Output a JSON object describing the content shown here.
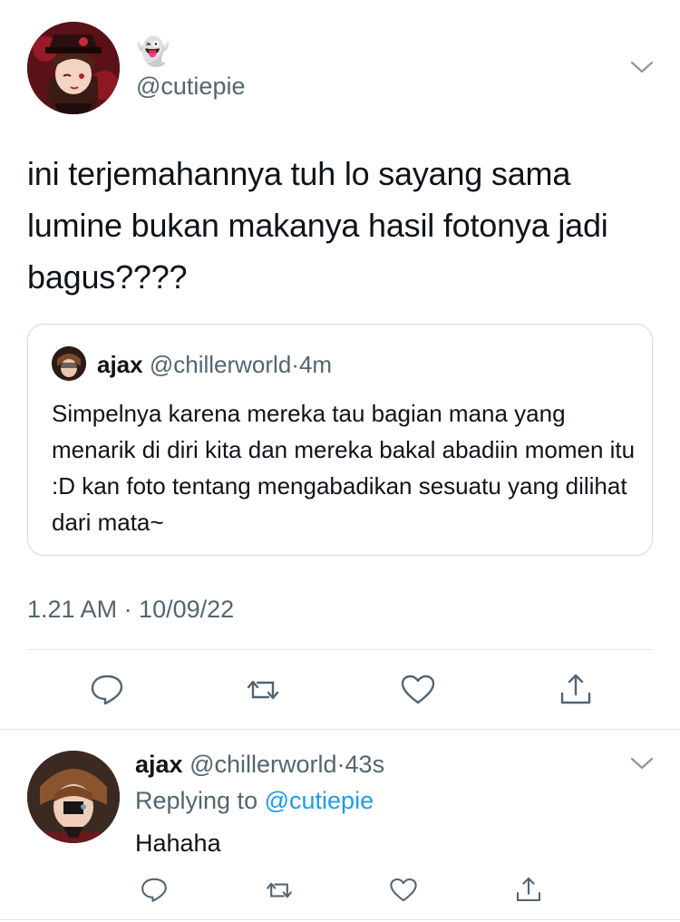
{
  "main_tweet": {
    "display_name_emoji": "👻",
    "handle": "@cutiepie",
    "text": "ini terjemahannya tuh lo sayang sama lumine bukan makanya hasil fotonya jadi bagus????",
    "timestamp": "1.21 AM · 10/09/22"
  },
  "quoted_tweet": {
    "name": "ajax",
    "handle": "@chillerworld",
    "separator": "·",
    "time": "4m",
    "text": "Simpelnya karena mereka tau bagian mana yang menarik di diri kita dan mereka bakal abadiin momen itu :D kan foto tentang mengabadikan sesuatu yang dilihat dari mata~"
  },
  "reply": {
    "name": "ajax",
    "handle": "@chillerworld",
    "separator": "·",
    "time": "43s",
    "replying_prefix": "Replying to",
    "replying_to": "@cutiepie",
    "text": "Hahaha"
  },
  "colors": {
    "text": "#0f1419",
    "secondary": "#536471",
    "accent": "#1d9bf0",
    "border": "#cfd9de"
  },
  "icons": [
    "chevron-down-icon",
    "reply-icon",
    "retweet-icon",
    "like-icon",
    "share-icon"
  ]
}
